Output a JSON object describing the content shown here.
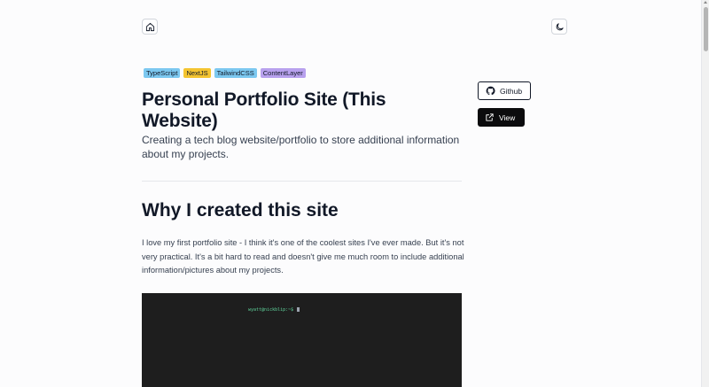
{
  "nav": {
    "home_icon": "home-icon",
    "theme_icon": "moon-icon"
  },
  "tags": [
    {
      "label": "TypeScript",
      "color": "#7cc8f0"
    },
    {
      "label": "NextJS",
      "color": "#f4c430"
    },
    {
      "label": "TailwindCSS",
      "color": "#7cc8f0"
    },
    {
      "label": "ContentLayer",
      "color": "#b8a1ee"
    }
  ],
  "project": {
    "title": "Personal Portfolio Site (This Website)",
    "subtitle": "Creating a tech blog website/portfolio to store additional information about my projects."
  },
  "actions": {
    "github_label": "Github",
    "view_label": "View"
  },
  "section": {
    "heading": "Why I created this site",
    "paragraph": "I love my first portfolio site - I think it's one of the coolest sites I've ever made. But it's not very practical. It's a bit hard to read and doesn't give me much room to include additional information/pictures about my projects."
  },
  "terminal": {
    "prompt": "wyatt@nickblip:~$"
  },
  "colors": {
    "background": "#fcfcfd",
    "terminal_bg": "#1e1e1e",
    "prompt_green": "#5fd39b"
  }
}
